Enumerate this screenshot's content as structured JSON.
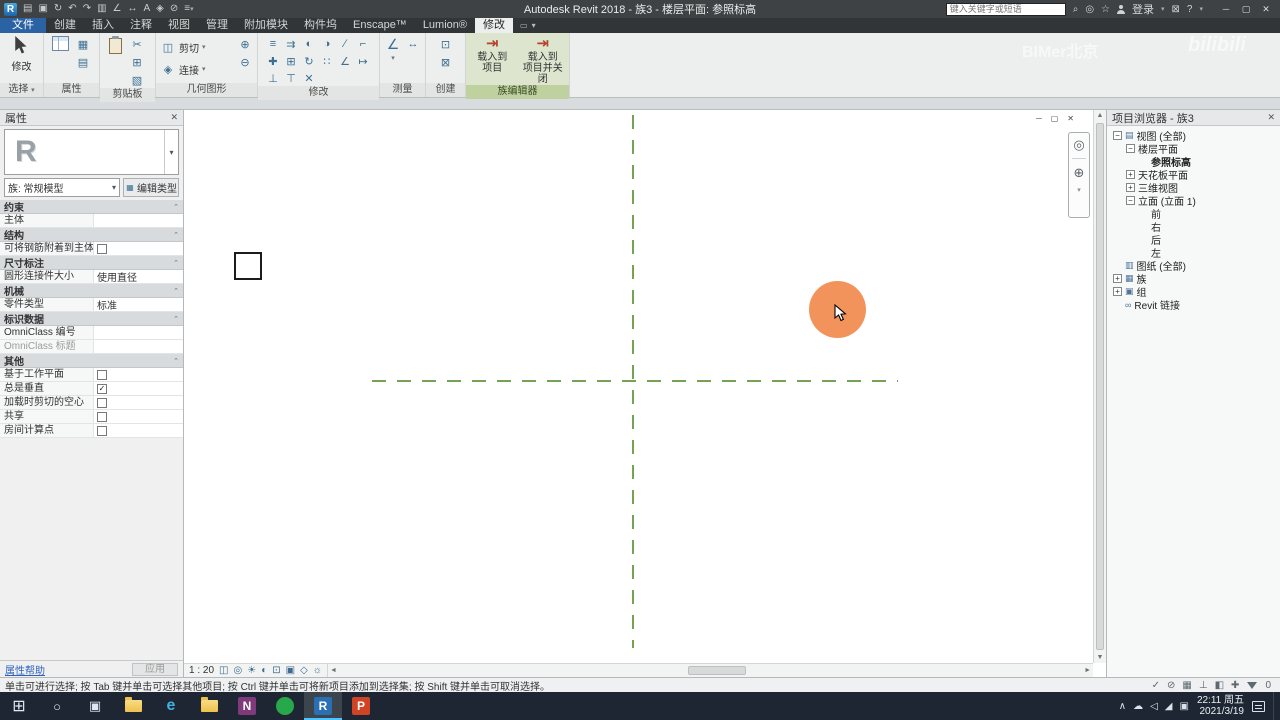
{
  "colors": {
    "titlebar_bg": "#3e4244",
    "tabrow_bg": "#313537",
    "ribbon_bg": "#edefee",
    "contextual_panel_bg": "#dde5cf",
    "contextual_label_bg": "#bfd19f",
    "reference_line_green": "#76a254",
    "click_highlight_orange": "#f28a4e",
    "taskbar_bg": "#1d2632",
    "file_tab_blue": "#2a62a4"
  },
  "titlebar": {
    "app_logo": "R",
    "title": "Autodesk Revit 2018 -    族3 - 楼层平面: 参照标高",
    "quick_access_icons": [
      {
        "name": "open-icon",
        "glyph": "▤"
      },
      {
        "name": "save-icon",
        "glyph": "▣"
      },
      {
        "name": "sync-icon",
        "glyph": "↻"
      },
      {
        "name": "undo-icon",
        "glyph": "↶"
      },
      {
        "name": "redo-icon",
        "glyph": "↷"
      },
      {
        "name": "print-icon",
        "glyph": "▥"
      },
      {
        "name": "measure-icon",
        "glyph": "∠"
      },
      {
        "name": "aligned-dimension-icon",
        "glyph": "↔"
      },
      {
        "name": "text-icon",
        "glyph": "A"
      },
      {
        "name": "default-3d-view-icon",
        "glyph": "◈"
      },
      {
        "name": "section-icon",
        "glyph": "⊘"
      },
      {
        "name": "thin-lines-icon",
        "glyph": "≡"
      }
    ],
    "search": {
      "placeholder": "键入关键字或短语"
    },
    "signin_label": "登录",
    "help_label": "?",
    "window_controls": [
      {
        "name": "minimize-button",
        "glyph": "─"
      },
      {
        "name": "maximize-button",
        "glyph": "▢"
      },
      {
        "name": "close-button",
        "glyph": "✕"
      }
    ]
  },
  "watermarks": {
    "bimer": "BIMer北京",
    "bilibili": "bilibili"
  },
  "ribbon_tabs": {
    "file_tab": "文件",
    "tabs": [
      {
        "key": "create",
        "label": "创建"
      },
      {
        "key": "insert",
        "label": "插入"
      },
      {
        "key": "annotate",
        "label": "注释"
      },
      {
        "key": "view",
        "label": "视图"
      },
      {
        "key": "manage",
        "label": "管理"
      },
      {
        "key": "addins",
        "label": "附加模块"
      },
      {
        "key": "bimstore",
        "label": "构件坞"
      },
      {
        "key": "enscape",
        "label": "Enscape™"
      },
      {
        "key": "lumion",
        "label": "Lumion®"
      },
      {
        "key": "modify",
        "label": "修改"
      }
    ],
    "active": "修改"
  },
  "ribbon_panels": {
    "select": {
      "label": "选择",
      "modify_button": "修改"
    },
    "properties": {
      "label": "属性",
      "icons": [
        {
          "name": "family-category-icon",
          "glyph": "▦"
        },
        {
          "name": "family-types-icon",
          "glyph": "▤"
        }
      ]
    },
    "clipboard": {
      "label": "剪贴板",
      "icons": [
        {
          "name": "cut-icon",
          "glyph": "✂"
        },
        {
          "name": "copy-icon",
          "glyph": "⊞"
        },
        {
          "name": "match-type-icon",
          "glyph": "▧"
        }
      ]
    },
    "geometry": {
      "label": "几何图形",
      "buttons": [
        {
          "label": "剪切"
        },
        {
          "label": "连接"
        }
      ],
      "side_icons": [
        {
          "name": "join-geometry-icon",
          "glyph": "⊕"
        },
        {
          "name": "unjoin-geometry-icon",
          "glyph": "⊖"
        }
      ]
    },
    "modify": {
      "label": "修改",
      "icons": [
        {
          "name": "align-icon",
          "glyph": "≡"
        },
        {
          "name": "offset-icon",
          "glyph": "⇉"
        },
        {
          "name": "mirror-pick-axis-icon",
          "glyph": "◐"
        },
        {
          "name": "mirror-draw-axis-icon",
          "glyph": "◑"
        },
        {
          "name": "split-element-icon",
          "glyph": "∕"
        },
        {
          "name": "trim-extend-icon",
          "glyph": "⌐"
        },
        {
          "name": "move-icon",
          "glyph": "✚"
        },
        {
          "name": "copy-element-icon",
          "glyph": "⊞"
        },
        {
          "name": "rotate-icon",
          "glyph": "↻"
        },
        {
          "name": "array-icon",
          "glyph": "∷"
        },
        {
          "name": "scale-icon",
          "glyph": "∠"
        },
        {
          "name": "extend-icon",
          "glyph": "↦"
        },
        {
          "name": "pin-icon",
          "glyph": "⊥"
        },
        {
          "name": "unpin-icon",
          "glyph": "⊤"
        },
        {
          "name": "delete-icon",
          "glyph": "✕"
        }
      ]
    },
    "measure": {
      "label": "测量",
      "icons": [
        {
          "name": "measure-between-refs-icon",
          "glyph": "∠"
        },
        {
          "name": "dimension-icon",
          "glyph": "↔"
        }
      ]
    },
    "create": {
      "label": "创建",
      "icons": [
        {
          "name": "create-group-icon",
          "glyph": "⊡"
        },
        {
          "name": "create-similar-icon",
          "glyph": "⊠"
        }
      ]
    },
    "family_editor": {
      "label": "族编辑器",
      "buttons": [
        {
          "name": "load-into-project-button",
          "line1": "载入到",
          "line2": "项目"
        },
        {
          "name": "load-into-project-close-button",
          "line1": "载入到",
          "line2": "项目并关闭"
        }
      ]
    }
  },
  "properties_palette": {
    "header": "属性",
    "preview_letter": "R",
    "type_selector": {
      "value": "族: 常规模型"
    },
    "edit_type_button": "编辑类型",
    "sections": [
      {
        "title": "约束",
        "rows": [
          {
            "label": "主体",
            "value": "",
            "type": "text"
          }
        ]
      },
      {
        "title": "结构",
        "rows": [
          {
            "label": "可将钢筋附着到主体",
            "type": "checkbox",
            "checked": false
          }
        ]
      },
      {
        "title": "尺寸标注",
        "rows": [
          {
            "label": "圆形连接件大小",
            "value": "使用直径",
            "type": "text"
          }
        ]
      },
      {
        "title": "机械",
        "rows": [
          {
            "label": "零件类型",
            "value": "标准",
            "type": "text"
          }
        ]
      },
      {
        "title": "标识数据",
        "rows": [
          {
            "label": "OmniClass 编号",
            "value": "",
            "type": "text"
          },
          {
            "label": "OmniClass 标题",
            "value": "",
            "type": "text",
            "disabled": true
          }
        ]
      },
      {
        "title": "其他",
        "rows": [
          {
            "label": "基于工作平面",
            "type": "checkbox",
            "checked": false
          },
          {
            "label": "总是垂直",
            "type": "checkbox",
            "checked": true
          },
          {
            "label": "加载时剪切的空心",
            "type": "checkbox",
            "checked": false
          },
          {
            "label": "共享",
            "type": "checkbox",
            "checked": false
          },
          {
            "label": "房间计算点",
            "type": "checkbox",
            "checked": false
          }
        ]
      }
    ],
    "help_link": "属性帮助",
    "apply_button": "应用"
  },
  "project_browser": {
    "header": "项目浏览器 - 族3",
    "items": [
      {
        "label": "视图 (全部)",
        "level": 0,
        "expand": "minus",
        "icon": "views-icon",
        "glyph": "▤"
      },
      {
        "label": "楼层平面",
        "level": 1,
        "expand": "minus"
      },
      {
        "label": "参照标高",
        "level": 2,
        "expand": "none",
        "bold": true
      },
      {
        "label": "天花板平面",
        "level": 1,
        "expand": "plus"
      },
      {
        "label": "三维视图",
        "level": 1,
        "expand": "plus"
      },
      {
        "label": "立面 (立面 1)",
        "level": 1,
        "expand": "minus"
      },
      {
        "label": "前",
        "level": 2,
        "expand": "none"
      },
      {
        "label": "右",
        "level": 2,
        "expand": "none"
      },
      {
        "label": "后",
        "level": 2,
        "expand": "none"
      },
      {
        "label": "左",
        "level": 2,
        "expand": "none"
      },
      {
        "label": "图纸 (全部)",
        "level": 0,
        "expand": "none",
        "icon": "sheets-icon",
        "glyph": "▥"
      },
      {
        "label": "族",
        "level": 0,
        "expand": "plus",
        "icon": "families-icon",
        "glyph": "▦"
      },
      {
        "label": "组",
        "level": 0,
        "expand": "plus",
        "icon": "groups-icon",
        "glyph": "▣"
      },
      {
        "label": "Revit 链接",
        "level": 0,
        "expand": "none",
        "icon": "revit-links-icon",
        "glyph": "∞"
      }
    ]
  },
  "canvas": {
    "view_scale": "1 : 20",
    "view_window_controls": [
      {
        "name": "minimize-view-button",
        "glyph": "─"
      },
      {
        "name": "restore-view-button",
        "glyph": "▢"
      },
      {
        "name": "close-view-button",
        "glyph": "✕"
      }
    ],
    "navigation_bar": [
      {
        "name": "steering-wheel-icon",
        "glyph": "◎"
      },
      {
        "name": "zoom-icon",
        "glyph": "⊕"
      }
    ],
    "view_control_icons": [
      {
        "name": "detail-level-icon",
        "glyph": "◫"
      },
      {
        "name": "visual-style-icon",
        "glyph": "◎"
      },
      {
        "name": "sun-path-icon",
        "glyph": "☀"
      },
      {
        "name": "shadows-icon",
        "glyph": "◐"
      },
      {
        "name": "crop-view-icon",
        "glyph": "⊡"
      },
      {
        "name": "show-crop-region-icon",
        "glyph": "▣"
      },
      {
        "name": "temporary-hide-isolate-icon",
        "glyph": "◇"
      },
      {
        "name": "reveal-hidden-elements-icon",
        "glyph": "☼"
      }
    ]
  },
  "status_bar": {
    "message": "单击可进行选择; 按 Tab 键并单击可选择其他项目; 按 Ctrl 键并单击可将新项目添加到选择集; 按 Shift 键并单击可取消选择。",
    "icons": [
      {
        "name": "editable-only-icon",
        "glyph": "✓"
      },
      {
        "name": "select-links-toggle-icon",
        "glyph": "⊘"
      },
      {
        "name": "select-underlay-toggle-icon",
        "glyph": "▦"
      },
      {
        "name": "select-pinned-toggle-icon",
        "glyph": "⊥"
      },
      {
        "name": "select-by-face-toggle-icon",
        "glyph": "◧"
      },
      {
        "name": "drag-on-selection-toggle-icon",
        "glyph": "✚"
      }
    ],
    "filter_count": "0"
  },
  "taskbar": {
    "icons": [
      {
        "name": "start-button",
        "glyph": "⊞",
        "color": "#dfe8f1",
        "size": 16
      },
      {
        "name": "search-button",
        "glyph": "○",
        "color": "#dfe8f1",
        "size": 13
      },
      {
        "name": "task-view-button",
        "glyph": "▣",
        "color": "#dfe8f1",
        "size": 13
      },
      {
        "name": "file-explorer-icon",
        "type": "folder"
      },
      {
        "name": "edge-icon",
        "glyph": "e",
        "color": "#41b0e3",
        "size": 16,
        "bold": true
      },
      {
        "name": "folder-window-icon",
        "type": "folder"
      },
      {
        "name": "onenote-icon",
        "glyph": "N",
        "bg": "#80397b"
      },
      {
        "name": "app-green-icon",
        "glyph": "",
        "bg": "#27a94b",
        "round": true
      },
      {
        "name": "revit-icon",
        "glyph": "R",
        "bg": "#2b6fb3",
        "active": true
      },
      {
        "name": "powerpoint-icon",
        "glyph": "P",
        "bg": "#d04423"
      }
    ],
    "tray": {
      "icons": [
        {
          "name": "hidden-icons-chevron",
          "glyph": "∧"
        },
        {
          "name": "cloud-icon",
          "glyph": "☁"
        },
        {
          "name": "volume-icon",
          "glyph": "◁"
        },
        {
          "name": "network-icon",
          "glyph": "◢"
        },
        {
          "name": "ime-icon",
          "glyph": "▣"
        }
      ],
      "time": "22:11 周五",
      "date": "2021/3/19"
    }
  }
}
